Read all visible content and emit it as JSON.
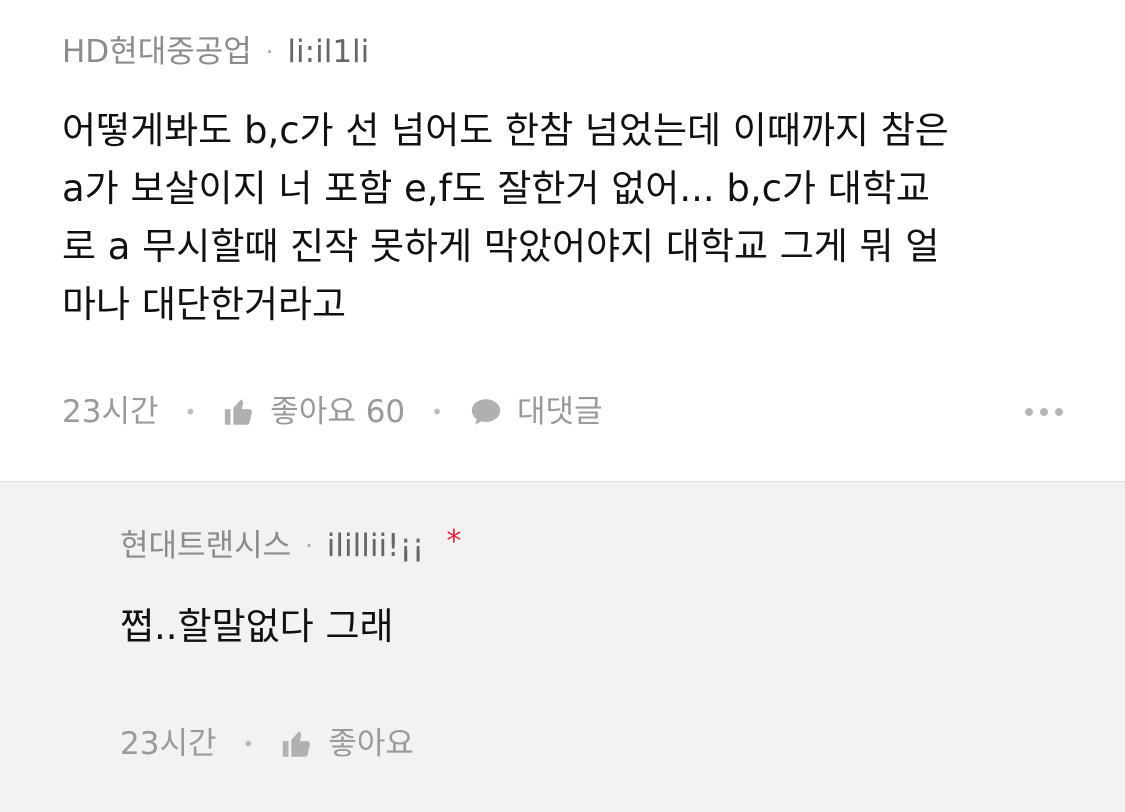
{
  "comments": [
    {
      "author_company": "HD현대중공업",
      "author_name": "li:il1li",
      "text": "어떻게봐도 b,c가 선 넘어도 한참 넘었는데 이때까지 참은\na가 보살이지 너 포함 e,f도 잘한거 없어... b,c가 대학교\n로 a 무시할때 진작 못하게 막았어야지 대학교 그게 뭐 얼\n마나 대단한거라고",
      "time": "23시간",
      "like_label": "좋아요 60",
      "reply_label": "대댓글",
      "icons": {
        "like": "thumbs-up-icon",
        "reply": "speech-bubble-icon",
        "more": "more-dots-icon"
      }
    }
  ],
  "reply": {
    "author_company": "현대트랜시스",
    "author_name": "ilillii!¡¡",
    "star": "*",
    "text": "쩝..할말없다 그래",
    "time": "23시간",
    "like_label": "좋아요",
    "icons": {
      "like": "thumbs-up-icon"
    }
  },
  "colors": {
    "meta_text": "#8c8c8c",
    "reply_background": "#f2f2f4",
    "star": "#e0283c",
    "icon": "#b0b0b0"
  }
}
